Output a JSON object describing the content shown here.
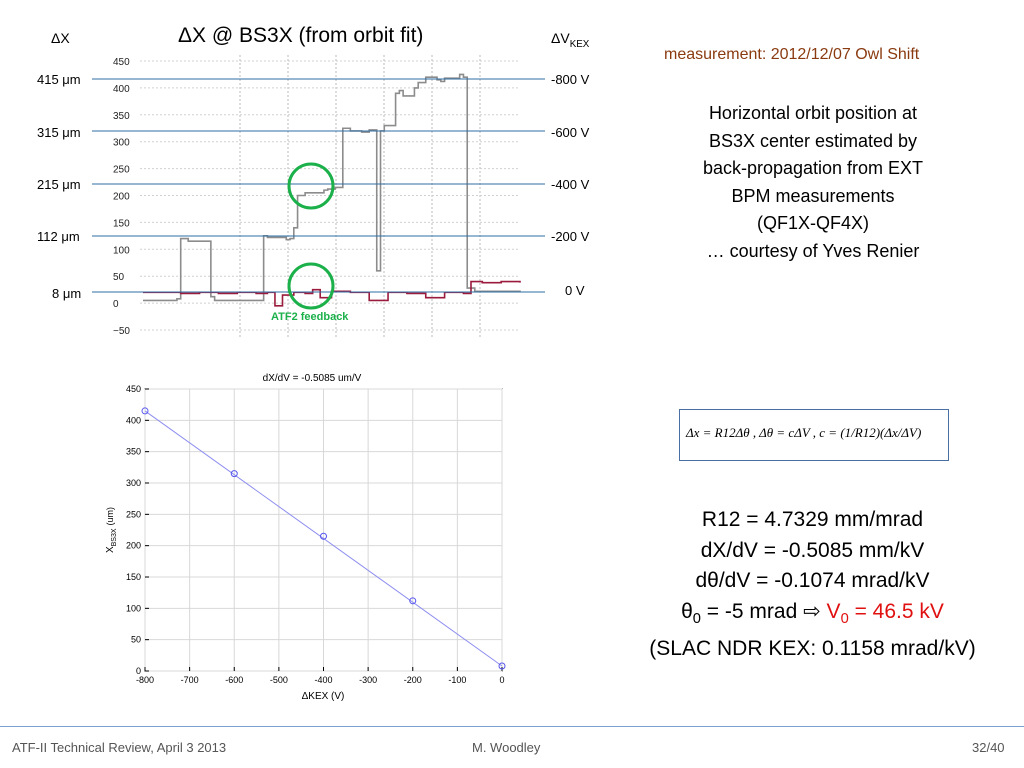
{
  "top": {
    "dx_header": "ΔX",
    "dv_header": "ΔV",
    "dv_header_sub": "KEX",
    "title": "ΔX @ BS3X (from orbit fit)",
    "left_labels": [
      "415 μm",
      "315 μm",
      "215 μm",
      "112 μm",
      "8 μm"
    ],
    "right_labels": [
      "-800 V",
      "-600 V",
      "-400 V",
      "-200 V",
      "0 V"
    ],
    "yticks": [
      "450",
      "400",
      "350",
      "300",
      "250",
      "200",
      "150",
      "100",
      "50",
      "0",
      "−50"
    ],
    "annotation": "ATF2 feedback"
  },
  "measurement": "measurement: 2012/12/07 Owl Shift",
  "description": [
    "Horizontal orbit position at",
    "BS3X center estimated by",
    "back-propagation from EXT",
    "BPM measurements",
    "(QF1X-QF4X)",
    "… courtesy of Yves Renier"
  ],
  "equation": "Δx = R12Δθ , Δθ = cΔV , c = (1/R12)(Δx/ΔV)",
  "results": {
    "r12": "R12 = 4.7329 mm/mrad",
    "dxdv": "dX/dV = -0.5085 mm/kV",
    "dthdv": "dθ/dV = -0.1074 mrad/kV",
    "theta_prefix": "θ",
    "theta_sub": "0",
    "theta_value": " = -5 mrad ",
    "arrow": "⇨",
    "v0_prefix": "V",
    "v0_sub": "0",
    "v0_value": " = 46.5 kV",
    "slac": "(SLAC NDR KEX: 0.1158 mrad/kV)"
  },
  "colors": {
    "grey_trace": "#8c8c8c",
    "red_trace": "#9b1b3c",
    "blue_lines": "#2e6da4",
    "green_circles": "#1bb04a",
    "accent_red": "#e01010",
    "fit_line": "#8e8ef0"
  },
  "footer": {
    "left": "ATF-II Technical Review, April 3 2013",
    "center": "M. Woodley",
    "right": "32/40"
  },
  "chart_data": [
    {
      "type": "line",
      "series": [
        {
          "color": "grey",
          "x": [
            0,
            6,
            9,
            10,
            12,
            18,
            19,
            31,
            32,
            33,
            38,
            39,
            40,
            41,
            43,
            48,
            49,
            51,
            53,
            55,
            58,
            60,
            62,
            63,
            64,
            67,
            68,
            69,
            72,
            73,
            75,
            78,
            79,
            80,
            84,
            85,
            86,
            88,
            100
          ],
          "y": [
            5,
            5,
            8,
            120,
            115,
            12,
            5,
            5,
            125,
            122,
            118,
            120,
            140,
            200,
            205,
            210,
            212,
            215,
            325,
            320,
            318,
            322,
            60,
            320,
            330,
            390,
            395,
            385,
            400,
            410,
            420,
            415,
            412,
            418,
            425,
            420,
            28,
            22,
            20
          ]
        },
        {
          "color": "red",
          "x": [
            0,
            10,
            15,
            20,
            25,
            30,
            33,
            35,
            37,
            40,
            43,
            45,
            47,
            50,
            55,
            60,
            65,
            70,
            75,
            80,
            85,
            87,
            90,
            95,
            100
          ],
          "y": [
            20,
            18,
            20,
            18,
            20,
            18,
            20,
            -5,
            15,
            20,
            18,
            25,
            10,
            22,
            20,
            5,
            20,
            18,
            10,
            20,
            18,
            40,
            38,
            40,
            38
          ]
        }
      ],
      "yticks": [
        450,
        400,
        350,
        300,
        250,
        200,
        150,
        100,
        50,
        0,
        -50
      ],
      "ylim": [
        -50,
        450
      ],
      "annotation": "ATF2 feedback"
    },
    {
      "type": "scatter",
      "title": "dX/dV = -0.5085 um/V",
      "xlabel": "ΔKEX (V)",
      "ylabel": "X",
      "ylabel_sub": "BS3X",
      "ylabel_unit": "(um)",
      "x": [
        -800,
        -600,
        -400,
        -200,
        0
      ],
      "y": [
        415,
        315,
        215,
        112,
        8
      ],
      "xticks": [
        -800,
        -700,
        -600,
        -500,
        -400,
        -300,
        -200,
        -100,
        0
      ],
      "yticks": [
        0,
        50,
        100,
        150,
        200,
        250,
        300,
        350,
        400,
        450
      ],
      "xlim": [
        -800,
        0
      ],
      "ylim": [
        0,
        450
      ],
      "grid": true
    }
  ]
}
